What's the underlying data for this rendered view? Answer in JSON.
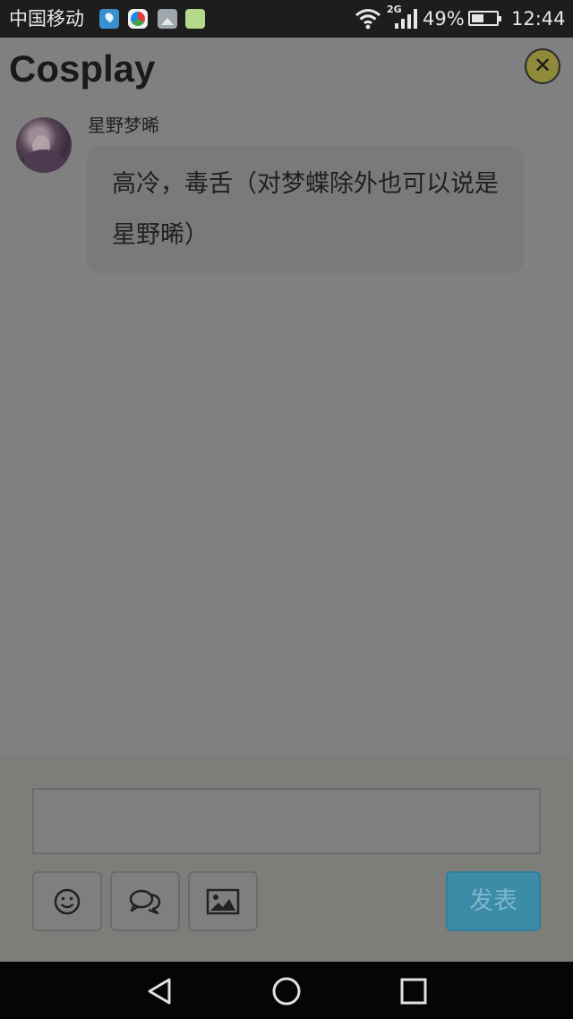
{
  "status_bar": {
    "carrier": "中国移动",
    "network_type": "2G",
    "battery_percent": "49%",
    "battery_level": 0.49,
    "time": "12:44",
    "icons": [
      "location-app-icon",
      "colorful-app-icon",
      "gallery-app-icon",
      "notes-app-icon",
      "wifi-icon",
      "signal-icon",
      "battery-icon"
    ]
  },
  "header": {
    "title": "Cosplay",
    "close_icon": "close-icon"
  },
  "message": {
    "sender": "星野梦晞",
    "text": "高冷，毒舌（对梦蝶除外也可以说是星野晞）"
  },
  "composer": {
    "input_value": "",
    "tools": [
      "smiley-icon",
      "chat-bubbles-icon",
      "image-icon"
    ],
    "send_label": "发表"
  },
  "nav_bar": {
    "buttons": [
      "back-icon",
      "home-icon",
      "recents-icon"
    ]
  },
  "colors": {
    "overlay": "#808080",
    "send_button": "#3c8ba7",
    "close_button": "#8f8a3a"
  }
}
